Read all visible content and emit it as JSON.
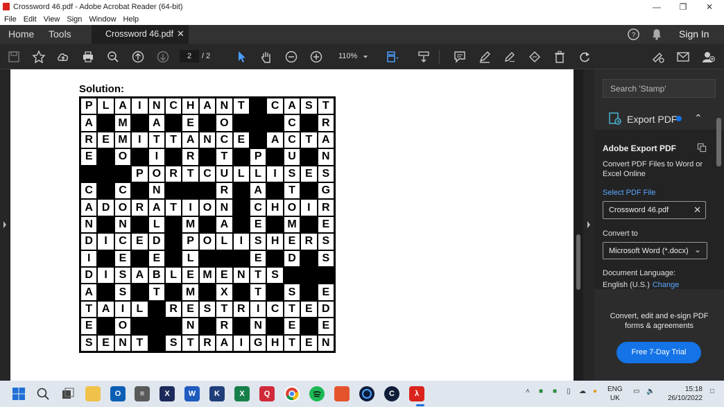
{
  "window": {
    "title": "Crossword 46.pdf - Adobe Acrobat Reader (64-bit)"
  },
  "menu": [
    "File",
    "Edit",
    "View",
    "Sign",
    "Window",
    "Help"
  ],
  "tabs": {
    "home": "Home",
    "tools": "Tools",
    "document": "Crossword 46.pdf",
    "sign_in": "Sign In"
  },
  "toolbar": {
    "page_current": "2",
    "page_total": "/ 2",
    "zoom": "110%"
  },
  "document": {
    "solution_label": "Solution:",
    "grid_rows": [
      "PLAINCHANT#CAST",
      "A#M#A#E#O###C#R",
      "REMITTANCE#ACTA",
      "E#O#I#R#T#P#U#N",
      "###PORTCULLISES",
      "C#C#N###R#A#T#G",
      "ADORATION#CHOIR",
      "N#N#L#M#A#E#M#E",
      "DICED#POLISHERS",
      "I#E#E#L###E#D#S",
      "DISABLEMENTS###",
      "A#S#T#M#X#T#S#E",
      "TAIL#RESTRICTED",
      "E#O###N#R#N#E#E",
      "SENT#STRAIGHTEN"
    ]
  },
  "right_panel": {
    "search_placeholder": "Search 'Stamp'",
    "export_header": "Export PDF",
    "title": "Adobe Export PDF",
    "description": "Convert PDF Files to Word or Excel Online",
    "select_link": "Select PDF File",
    "selected_file": "Crossword 46.pdf",
    "convert_to_label": "Convert to",
    "convert_to_value": "Microsoft Word (*.docx)",
    "doc_language_label": "Document Language:",
    "doc_language_value": "English (U.S.)",
    "change_link": "Change",
    "promo_text": "Convert, edit and e-sign PDF forms & agreements",
    "trial_button": "Free 7-Day Trial"
  },
  "taskbar": {
    "lang_top": "ENG",
    "lang_bottom": "UK",
    "time": "15:18",
    "date": "26/10/2022"
  }
}
